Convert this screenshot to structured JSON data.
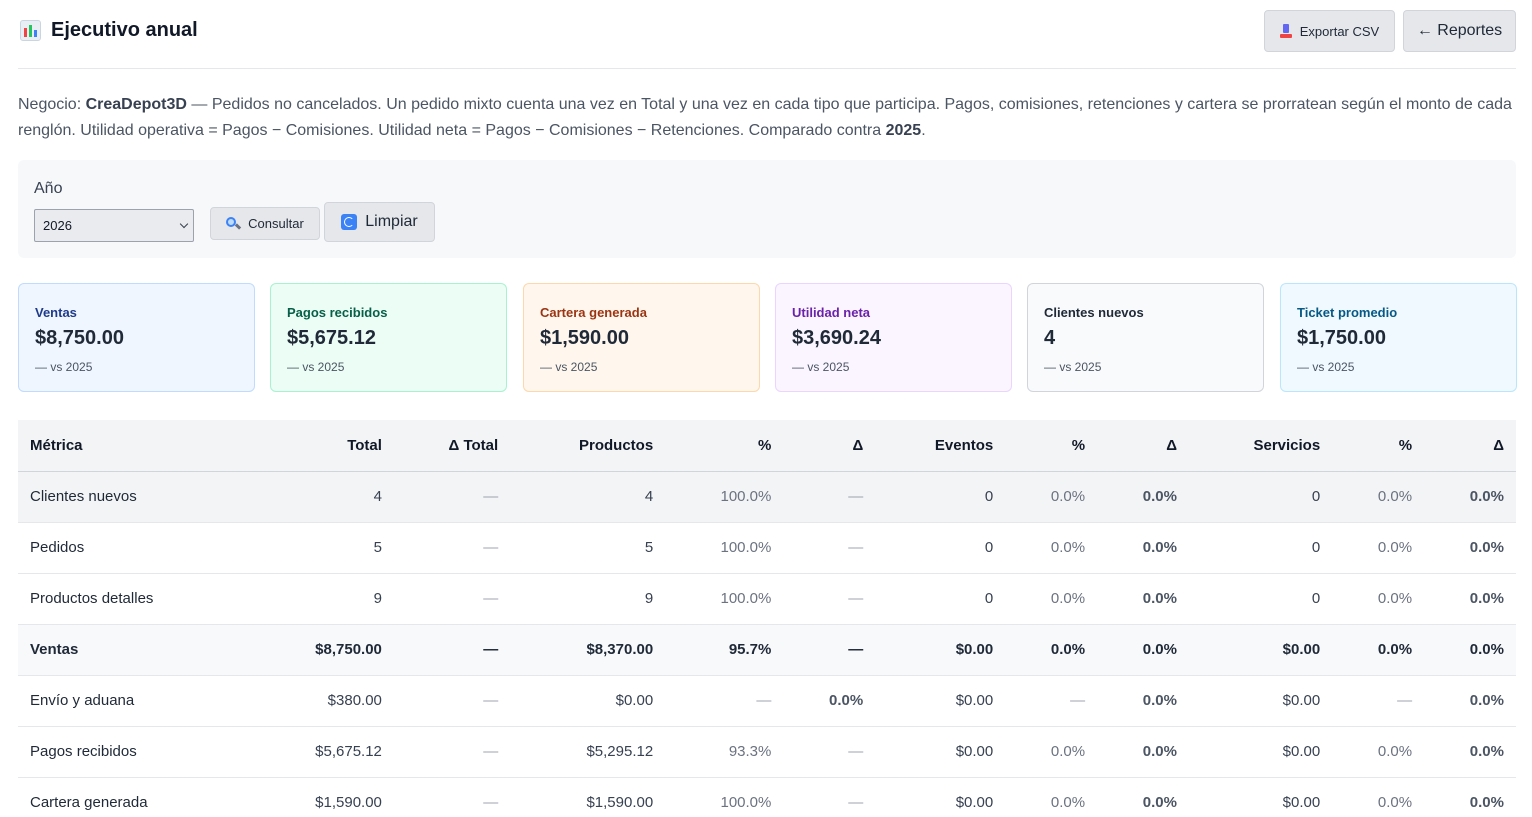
{
  "header": {
    "title": "Ejecutivo anual",
    "export_label": "Exportar CSV",
    "reportes_label": "← Reportes"
  },
  "description": {
    "prefix": "Negocio: ",
    "business": "CreaDepot3D",
    "text": " — Pedidos no cancelados. Un pedido mixto cuenta una vez en Total y una vez en cada tipo que participa. Pagos, comisiones, retenciones y cartera se prorratean según el monto de cada renglón. Utilidad operativa = Pagos − Comisiones. Utilidad neta = Pagos − Comisiones − Retenciones. Comparado contra ",
    "compare_year": "2025",
    "suffix": "."
  },
  "filter": {
    "year_label": "Año",
    "year_value": "2026",
    "consultar_label": "Consultar",
    "limpiar_label": "Limpiar"
  },
  "cards": [
    {
      "title": "Ventas",
      "value": "$8,750.00",
      "sub": "— vs 2025",
      "bg": "#eff6ff",
      "border": "#bfdbfe",
      "color": "#1e3a8a"
    },
    {
      "title": "Pagos recibidos",
      "value": "$5,675.12",
      "sub": "— vs 2025",
      "bg": "#ecfdf5",
      "border": "#a7f3d0",
      "color": "#065f46"
    },
    {
      "title": "Cartera generada",
      "value": "$1,590.00",
      "sub": "— vs 2025",
      "bg": "#fff7ed",
      "border": "#fed7aa",
      "color": "#9a3412"
    },
    {
      "title": "Utilidad neta",
      "value": "$3,690.24",
      "sub": "— vs 2025",
      "bg": "#faf5ff",
      "border": "#e9d5ff",
      "color": "#6b21a8"
    },
    {
      "title": "Clientes nuevos",
      "value": "4",
      "sub": "— vs 2025",
      "bg": "#f9fafb",
      "border": "#d1d5db",
      "color": "#1f2937"
    },
    {
      "title": "Ticket promedio",
      "value": "$1,750.00",
      "sub": "— vs 2025",
      "bg": "#f0f9ff",
      "border": "#bae6fd",
      "color": "#075985"
    }
  ],
  "table": {
    "headers": [
      "Métrica",
      "Total",
      "Δ Total",
      "Productos",
      "%",
      "Δ",
      "Eventos",
      "%",
      "Δ",
      "Servicios",
      "%",
      "Δ"
    ],
    "rows": [
      [
        "Clientes nuevos",
        "4",
        "—",
        "4",
        "100.0%",
        "—",
        "0",
        "0.0%",
        "0.0%",
        "0",
        "0.0%",
        "0.0%"
      ],
      [
        "Pedidos",
        "5",
        "—",
        "5",
        "100.0%",
        "—",
        "0",
        "0.0%",
        "0.0%",
        "0",
        "0.0%",
        "0.0%"
      ],
      [
        "Productos detalles",
        "9",
        "—",
        "9",
        "100.0%",
        "—",
        "0",
        "0.0%",
        "0.0%",
        "0",
        "0.0%",
        "0.0%"
      ],
      [
        "Ventas",
        "$8,750.00",
        "—",
        "$8,370.00",
        "95.7%",
        "—",
        "$0.00",
        "0.0%",
        "0.0%",
        "$0.00",
        "0.0%",
        "0.0%"
      ],
      [
        "Envío y aduana",
        "$380.00",
        "—",
        "$0.00",
        "—",
        "0.0%",
        "$0.00",
        "—",
        "0.0%",
        "$0.00",
        "—",
        "0.0%"
      ],
      [
        "Pagos recibidos",
        "$5,675.12",
        "—",
        "$5,295.12",
        "93.3%",
        "—",
        "$0.00",
        "0.0%",
        "0.0%",
        "$0.00",
        "0.0%",
        "0.0%"
      ],
      [
        "Cartera generada",
        "$1,590.00",
        "—",
        "$1,590.00",
        "100.0%",
        "—",
        "$0.00",
        "0.0%",
        "0.0%",
        "$0.00",
        "0.0%",
        "0.0%"
      ]
    ]
  }
}
